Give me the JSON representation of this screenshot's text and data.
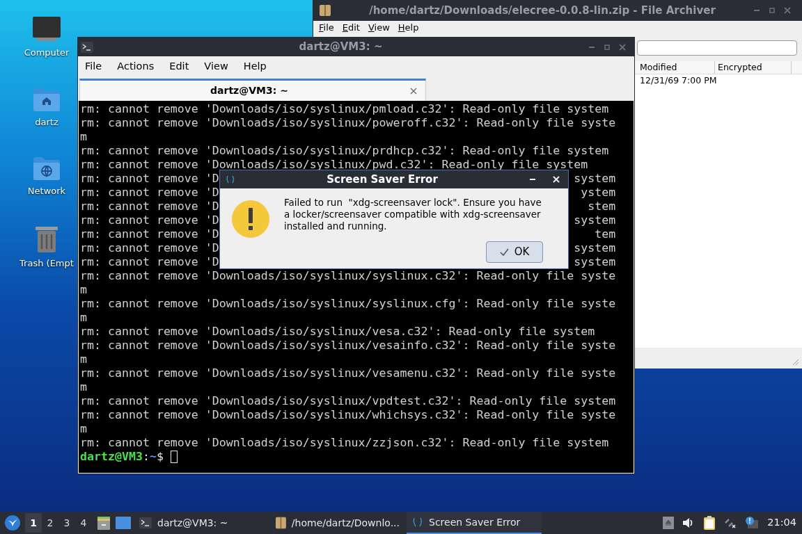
{
  "desktop_icons": [
    {
      "label": "Computer",
      "kind": "computer"
    },
    {
      "label": "dartz",
      "kind": "home"
    },
    {
      "label": "Network",
      "kind": "network"
    },
    {
      "label": "Trash (Empt",
      "kind": "trash"
    }
  ],
  "archiver_window": {
    "title": "/home/dartz/Downloads/elecree-0.0.8-lin.zip - File Archiver",
    "menu": [
      "File",
      "Edit",
      "View",
      "Help"
    ],
    "columns": [
      "Modified",
      "Encrypted"
    ],
    "rows": [
      [
        "12/31/69 7:00 PM"
      ]
    ]
  },
  "terminal_window": {
    "title": "dartz@VM3: ~",
    "menu": [
      "File",
      "Actions",
      "Edit",
      "View",
      "Help"
    ],
    "tabs": [
      {
        "label": "dartz@VM3: ~",
        "selected": true
      }
    ],
    "lines": [
      {
        "text": "rm: cannot remove 'Downloads/iso/syslinux/pmload.c32': Read-only file system"
      },
      {
        "text": "rm: cannot remove 'Downloads/iso/syslinux/poweroff.c32': Read-only file syste"
      },
      {
        "text": "m"
      },
      {
        "text": "rm: cannot remove 'Downloads/iso/syslinux/prdhcp.c32': Read-only file system"
      },
      {
        "text": "rm: cannot remove 'Downloads/iso/syslinux/pwd.c32': Read-only file system"
      },
      {
        "left": "rm: cannot remove 'D",
        "right": "system"
      },
      {
        "left": "rm: cannot remove 'D",
        "right": "ystem"
      },
      {
        "left": "rm: cannot remove 'D",
        "right": "stem"
      },
      {
        "left": "rm: cannot remove 'D",
        "right": "system"
      },
      {
        "left": "rm: cannot remove 'D",
        "right": "tem"
      },
      {
        "left": "rm: cannot remove 'D",
        "right": "system"
      },
      {
        "left": "rm: cannot remove 'D",
        "right": "system"
      },
      {
        "text": "rm: cannot remove 'Downloads/iso/syslinux/syslinux.c32': Read-only file syste"
      },
      {
        "text": "m"
      },
      {
        "text": "rm: cannot remove 'Downloads/iso/syslinux/syslinux.cfg': Read-only file syste"
      },
      {
        "text": "m"
      },
      {
        "text": "rm: cannot remove 'Downloads/iso/syslinux/vesa.c32': Read-only file system"
      },
      {
        "text": "rm: cannot remove 'Downloads/iso/syslinux/vesainfo.c32': Read-only file syste"
      },
      {
        "text": "m"
      },
      {
        "text": "rm: cannot remove 'Downloads/iso/syslinux/vesamenu.c32': Read-only file syste"
      },
      {
        "text": "m"
      },
      {
        "text": "rm: cannot remove 'Downloads/iso/syslinux/vpdtest.c32': Read-only file system"
      },
      {
        "text": "rm: cannot remove 'Downloads/iso/syslinux/whichsys.c32': Read-only file syste"
      },
      {
        "text": "m"
      },
      {
        "text": "rm: cannot remove 'Downloads/iso/syslinux/zzjson.c32': Read-only file system"
      }
    ],
    "prompt": [
      {
        "text": "dartz@VM3",
        "kind": "user"
      },
      {
        "text": ":",
        "kind": "plain"
      },
      {
        "text": "~",
        "kind": "path"
      },
      {
        "text": "$",
        "kind": "plain"
      }
    ]
  },
  "dialog": {
    "title": "Screen Saver Error",
    "message": "Failed to run  \"xdg-screensaver lock\". Ensure you have a locker/screensaver compatible with xdg-screensaver installed and running.",
    "buttons": [
      {
        "label": "OK",
        "default": true
      }
    ]
  },
  "taskbar": {
    "workspaces": [
      {
        "label": "1",
        "selected": true
      },
      {
        "label": "2",
        "selected": false
      },
      {
        "label": "3",
        "selected": false
      },
      {
        "label": "4",
        "selected": false
      }
    ],
    "tasks": [
      {
        "label": "dartz@VM3: ~",
        "kind": "terminal",
        "selected": false
      },
      {
        "label": "/home/dartz/Downlo...",
        "kind": "archive",
        "selected": false
      },
      {
        "label": "Screen Saver Error",
        "kind": "dialog",
        "selected": true
      }
    ],
    "clock": "21:04"
  }
}
